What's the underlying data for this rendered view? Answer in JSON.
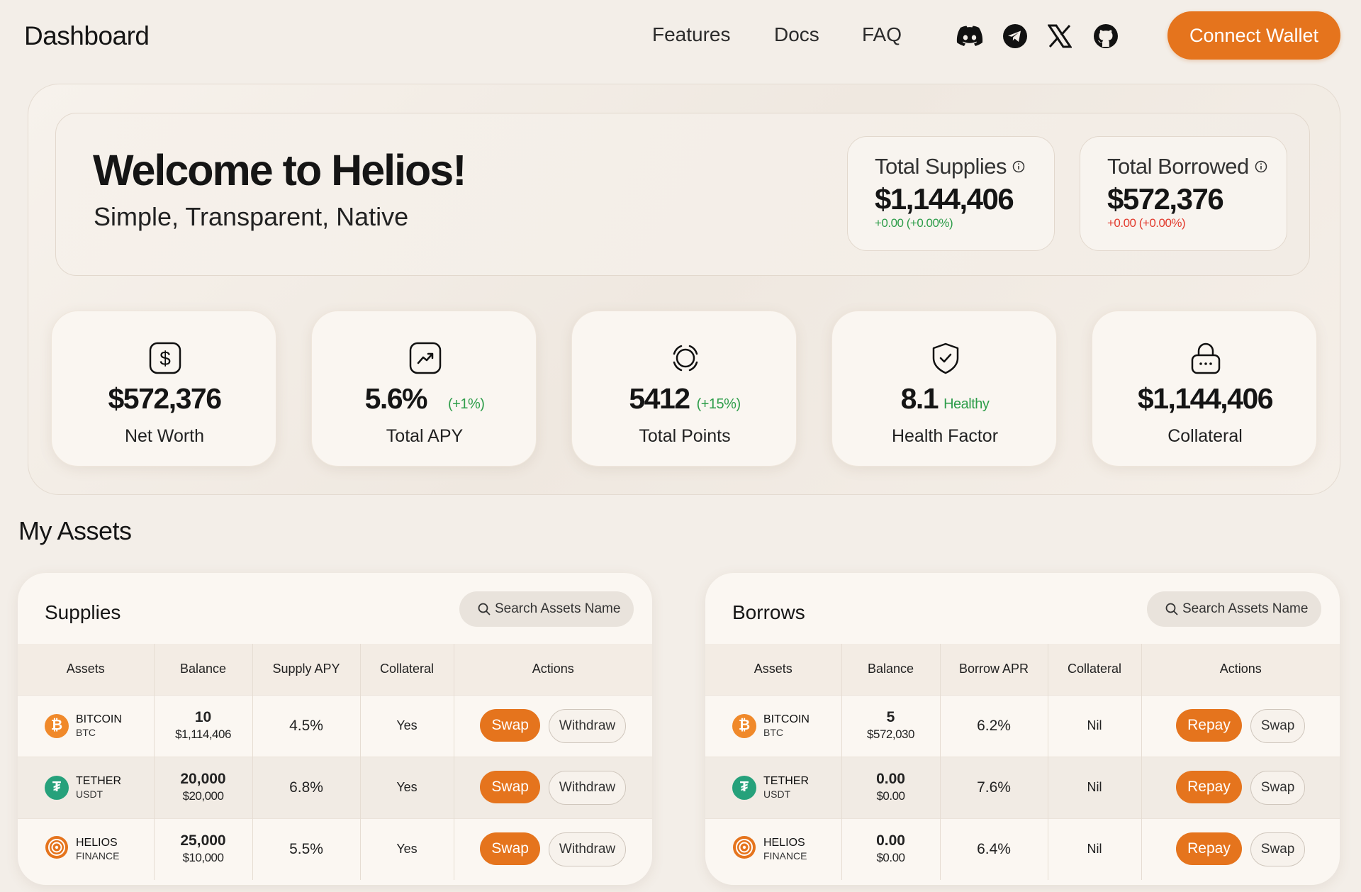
{
  "nav": {
    "brand": "Dashboard",
    "links": [
      "Features",
      "Docs",
      "FAQ"
    ],
    "social_icons": [
      "discord-icon",
      "telegram-icon",
      "x-icon",
      "github-icon"
    ],
    "connect_label": "Connect Wallet"
  },
  "hero": {
    "title": "Welcome to Helios!",
    "subtitle": "Simple, Transparent, Native",
    "total_supplies": {
      "label": "Total Supplies",
      "value": "$1,144,406",
      "change": "+0.00 (+0.00%)",
      "change_color": "#2e9d4a"
    },
    "total_borrowed": {
      "label": "Total Borrowed",
      "value": "$572,376",
      "change": "+0.00 (+0.00%)",
      "change_color": "#e23b2e"
    }
  },
  "stats": [
    {
      "icon": "dollar-icon",
      "value": "$572,376",
      "sub": "",
      "label": "Net Worth"
    },
    {
      "icon": "trend-up-icon",
      "value": "5.6%",
      "sub": "(+1%)",
      "label": "Total APY"
    },
    {
      "icon": "points-icon",
      "value": "5412",
      "sub": "(+15%)",
      "label": "Total Points"
    },
    {
      "icon": "shield-check-icon",
      "value": "8.1",
      "sub": "Healthy",
      "label": "Health Factor"
    },
    {
      "icon": "lock-icon",
      "value": "$1,144,406",
      "sub": "",
      "label": "Collateral"
    }
  ],
  "assets": {
    "title": "My Assets",
    "supplies": {
      "title": "Supplies",
      "search_placeholder": "Search Assets Name",
      "columns": [
        "Assets",
        "Balance",
        "Supply APY",
        "Collateral",
        "Actions"
      ],
      "rows": [
        {
          "name": "BITCOIN",
          "symbol": "BTC",
          "balance": "10",
          "balance_usd": "$1,114,406",
          "apy": "4.5%",
          "collateral": "Yes",
          "primary": "Swap",
          "secondary": "Withdraw"
        },
        {
          "name": "TETHER",
          "symbol": "USDT",
          "balance": "20,000",
          "balance_usd": "$20,000",
          "apy": "6.8%",
          "collateral": "Yes",
          "primary": "Swap",
          "secondary": "Withdraw"
        },
        {
          "name": "HELIOS",
          "symbol": "FINANCE",
          "balance": "25,000",
          "balance_usd": "$10,000",
          "apy": "5.5%",
          "collateral": "Yes",
          "primary": "Swap",
          "secondary": "Withdraw"
        }
      ]
    },
    "borrows": {
      "title": "Borrows",
      "search_placeholder": "Search Assets Name",
      "columns": [
        "Assets",
        "Balance",
        "Borrow APR",
        "Collateral",
        "Actions"
      ],
      "rows": [
        {
          "name": "BITCOIN",
          "symbol": "BTC",
          "balance": "5",
          "balance_usd": "$572,030",
          "apy": "6.2%",
          "collateral": "Nil",
          "primary": "Repay",
          "secondary": "Swap"
        },
        {
          "name": "TETHER",
          "symbol": "USDT",
          "balance": "0.00",
          "balance_usd": "$0.00",
          "apy": "7.6%",
          "collateral": "Nil",
          "primary": "Repay",
          "secondary": "Swap"
        },
        {
          "name": "HELIOS",
          "symbol": "FINANCE",
          "balance": "0.00",
          "balance_usd": "$0.00",
          "apy": "6.4%",
          "collateral": "Nil",
          "primary": "Repay",
          "secondary": "Swap"
        }
      ]
    }
  },
  "colors": {
    "accent": "#e5741d",
    "positive": "#2e9d4a",
    "negative": "#e23b2e",
    "btc": "#f0892a",
    "usdt": "#26a17b",
    "helios": "#e5741d"
  }
}
